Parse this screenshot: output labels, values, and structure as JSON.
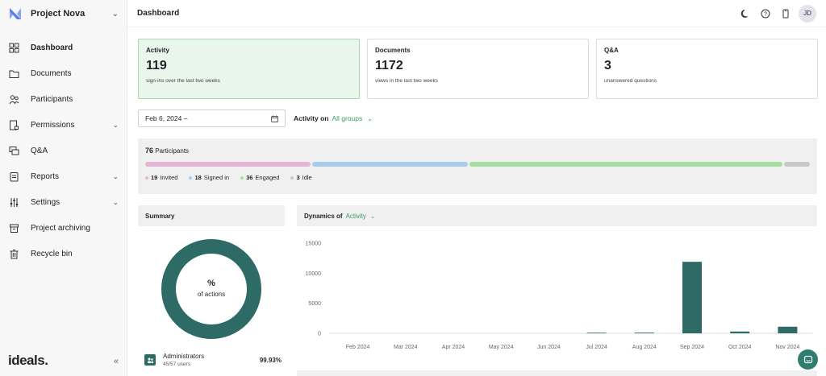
{
  "project": {
    "name": "Project Nova"
  },
  "brand": "ideals.",
  "sidebar": {
    "items": [
      {
        "label": "Dashboard",
        "icon": "dashboard-icon",
        "active": true
      },
      {
        "label": "Documents",
        "icon": "documents-icon"
      },
      {
        "label": "Participants",
        "icon": "participants-icon"
      },
      {
        "label": "Permissions",
        "icon": "permissions-icon",
        "has_submenu": true
      },
      {
        "label": "Q&A",
        "icon": "qa-icon"
      },
      {
        "label": "Reports",
        "icon": "reports-icon",
        "has_submenu": true
      },
      {
        "label": "Settings",
        "icon": "settings-icon",
        "has_submenu": true
      },
      {
        "label": "Project archiving",
        "icon": "archive-icon"
      },
      {
        "label": "Recycle bin",
        "icon": "trash-icon"
      }
    ],
    "collapse_glyph": "«"
  },
  "header": {
    "title": "Dashboard",
    "avatar_initials": "JD"
  },
  "stats": [
    {
      "title": "Activity",
      "value": "119",
      "subtitle": "sign-ins over the last two weeks",
      "active": true
    },
    {
      "title": "Documents",
      "value": "1172",
      "subtitle": "views in the last two weeks"
    },
    {
      "title": "Q&A",
      "value": "3",
      "subtitle": "unanswered questions"
    }
  ],
  "filters": {
    "date_value": "Feb 6, 2024 –",
    "activity_label": "Activity on",
    "activity_group": "All groups"
  },
  "participants": {
    "count": "76",
    "label": "Participants",
    "segments": [
      {
        "count": 19,
        "label": "Invited",
        "color": "#e4b7d9"
      },
      {
        "count": 18,
        "label": "Signed in",
        "color": "#a8cde8"
      },
      {
        "count": 36,
        "label": "Engaged",
        "color": "#a7dfa0"
      },
      {
        "count": 3,
        "label": "Idle",
        "color": "#c8c8c8"
      }
    ]
  },
  "summary": {
    "title": "Summary",
    "donut_percent_label": "%",
    "donut_sub_label": "of actions",
    "color": "#2e6b67",
    "row": {
      "name": "Administrators",
      "users": "45/57 users",
      "percent": "99.93%"
    }
  },
  "dynamics": {
    "label": "Dynamics of",
    "metric": "Activity"
  },
  "chart_data": {
    "type": "bar",
    "categories": [
      "Feb 2024",
      "Mar 2024",
      "Apr 2024",
      "May 2024",
      "Jun 2024",
      "Jul 2024",
      "Aug 2024",
      "Sep 2024",
      "Oct 2024",
      "Nov 2024"
    ],
    "values": [
      0,
      0,
      0,
      0,
      0,
      20,
      120,
      11900,
      300,
      1100
    ],
    "yticks": [
      0,
      5000,
      10000,
      15000
    ],
    "ylim": [
      0,
      15000
    ],
    "color": "#2e6b67",
    "title": "",
    "xlabel": "",
    "ylabel": ""
  }
}
